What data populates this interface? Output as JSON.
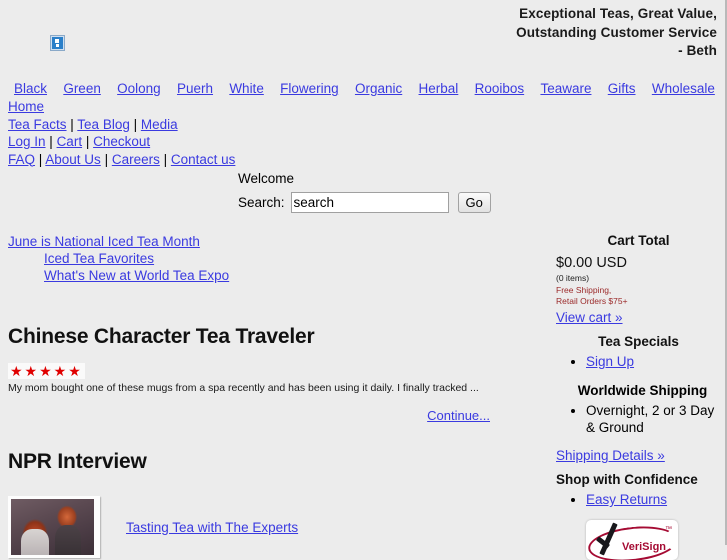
{
  "header": {
    "broken_image_icon": "broken-image-icon",
    "tagline_line1": "Exceptional Teas, Great Value,",
    "tagline_line2": "Outstanding Customer Service",
    "tagline_line3": "- Beth"
  },
  "topnav": {
    "categories": [
      "Black",
      "Green",
      "Oolong",
      "Puerh",
      "White",
      "Flowering",
      "Organic",
      "Herbal",
      "Rooibos",
      "Teaware",
      "Gifts",
      "Wholesale"
    ],
    "home": "Home",
    "row2": [
      "Tea Facts",
      "Tea Blog",
      "Media"
    ],
    "row3": [
      "Log In",
      "Cart",
      "Checkout"
    ],
    "row4": [
      "FAQ",
      "About Us",
      "Careers",
      "Contact us"
    ],
    "separator": " | "
  },
  "search": {
    "welcome": "Welcome",
    "label": "Search:",
    "value": "search",
    "placeholder": "search",
    "go_label": "Go"
  },
  "news": {
    "items": [
      "June is National Iced Tea Month",
      "Iced Tea Favorites",
      "What's New at World Tea Expo"
    ]
  },
  "articles": [
    {
      "title": "Chinese Character Tea Traveler",
      "stars": "★★★★★",
      "star_count": 5,
      "excerpt": "My mom bought one of these mugs from a spa recently and has been using it daily. I finally tracked ...",
      "continue_label": "Continue..."
    },
    {
      "title": "NPR Interview",
      "thumb_alt": "npr-interview-photo",
      "link_label": "Tasting Tea with The Experts"
    }
  ],
  "sidebar": {
    "cart_total_heading": "Cart Total",
    "cart_amount": "$0.00 USD",
    "cart_items": "(0 items)",
    "cart_note_line1": "Free Shipping,",
    "cart_note_line2": "Retail Orders $75+",
    "view_cart_label": "View cart »",
    "tea_specials_heading": "Tea Specials",
    "tea_specials_items": [
      "Sign Up"
    ],
    "worldwide_shipping_heading": "Worldwide Shipping",
    "worldwide_shipping_items": [
      "Overnight, 2 or 3 Day & Ground"
    ],
    "shipping_details_label": "Shipping Details »",
    "shop_confidence_heading": "Shop with Confidence",
    "shop_confidence_items": [
      "Easy Returns"
    ],
    "verisign_label": "VeriSign",
    "verisign_tm": "™"
  },
  "colors": {
    "background": "#ececec",
    "link": "#3a3ae0",
    "star_red": "#e00000",
    "note_red": "#9b2a2a",
    "verisign_red": "#a50b33"
  }
}
